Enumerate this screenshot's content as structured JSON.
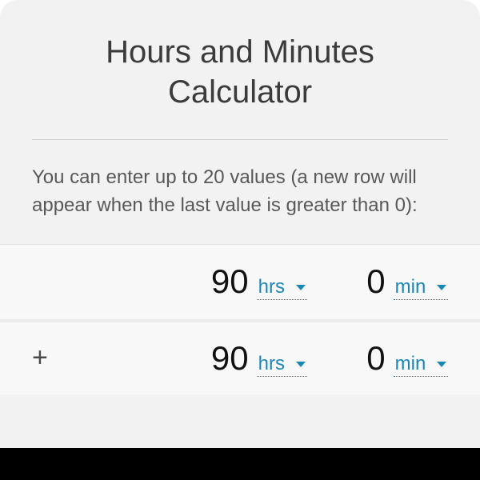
{
  "header": {
    "title": "Hours and Minutes Calculator"
  },
  "intro": "You can enter up to 20 values (a new row will appear when the last value is greater than 0):",
  "units": {
    "hrs_label": "hrs ",
    "min_label": "min "
  },
  "rows": [
    {
      "operator": "",
      "hours": "90",
      "minutes": "0"
    },
    {
      "operator": "+",
      "hours": "90",
      "minutes": "0"
    }
  ]
}
